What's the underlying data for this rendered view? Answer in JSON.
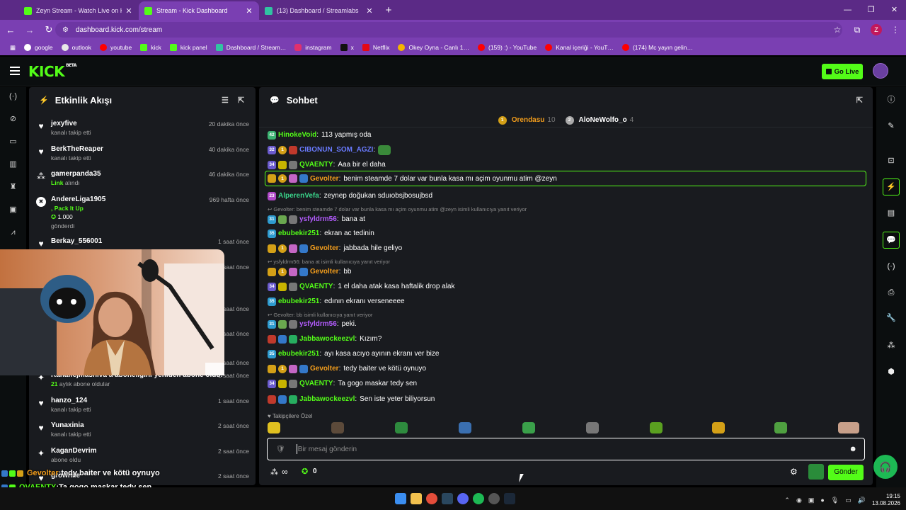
{
  "browser": {
    "tabs": [
      {
        "title": "Zeyn Stream - Watch Live on Ki…",
        "active": false
      },
      {
        "title": "Stream - Kick Dashboard",
        "active": true
      },
      {
        "title": "(13) Dashboard / Streamlabs",
        "active": false
      }
    ],
    "new_tab": "+",
    "url": "dashboard.kick.com/stream",
    "profile_initial": "Z",
    "bookmarks": [
      "google",
      "outlook",
      "youtube",
      "kick",
      "kick panel",
      "Dashboard / Stream…",
      "instagram",
      "x",
      "Netflix",
      "Okey Oyna - Canlı 1…",
      "(159) :) - YouTube",
      "Kanal içeriği - YouT…",
      "(174) Mc yayın gelin…"
    ]
  },
  "header": {
    "logo": "KICK",
    "beta": "BETA",
    "go_live": "Go Live"
  },
  "activity": {
    "title": "Etkinlik Akışı",
    "events": [
      {
        "name": "jexyfive",
        "sub": "kanalı takip etti",
        "time": "20 dakika önce",
        "icon": "heart-icon"
      },
      {
        "name": "BerkTheReaper",
        "sub": "kanalı takip etti",
        "time": "40 dakika önce",
        "icon": "heart-icon"
      },
      {
        "name": "gamerpanda35",
        "sub_highlight": "Link",
        "sub": "alındı",
        "time": "46 dakika önce",
        "icon": "redeem-icon"
      },
      {
        "name": "AndereLiga1905",
        "sub_highlight": ", Pack It Up",
        "amount": "1.000",
        "sub": "gönderdi",
        "time": "969 hafta önce",
        "icon": "kick-icon"
      },
      {
        "name": "Berkay_556001",
        "sub": "",
        "time": "1 saat önce",
        "icon": "heart-icon"
      },
      {
        "name": "",
        "sub": "",
        "time": "1 saat önce",
        "icon": ""
      },
      {
        "name": "",
        "sub": "",
        "time": "1 saat önce",
        "icon": ""
      },
      {
        "name": "",
        "sub": "",
        "time": "1 saat önce",
        "icon": ""
      },
      {
        "name": "",
        "sub": "",
        "time": "1 saat önce",
        "icon": ""
      },
      {
        "name": "Kanalfejmashiva a aboneliğini yeniden abone oldu!",
        "sub_highlight": "21",
        "sub": "aylık abone oldular",
        "time": "1 saat önce",
        "icon": "sparkle-icon"
      },
      {
        "name": "hanzo_124",
        "sub": "kanalı takip etti",
        "time": "1 saat önce",
        "icon": "heart-icon"
      },
      {
        "name": "Yunaxinia",
        "sub": "kanalı takip etti",
        "time": "2 saat önce",
        "icon": "heart-icon"
      },
      {
        "name": "KaganDevrim",
        "sub": "abone oldu",
        "time": "2 saat önce",
        "icon": "sparkle-icon"
      },
      {
        "name": "grownile",
        "sub": "",
        "time": "2 saat önce",
        "icon": "heart-icon"
      }
    ]
  },
  "chat": {
    "title": "Sohbet",
    "pinned": [
      {
        "name": "Orendasu",
        "count": "10"
      },
      {
        "name": "AloNeWolfo_o",
        "count": "4"
      }
    ],
    "messages": [
      {
        "badges": [
          "#3cb371:42"
        ],
        "user": "HinokeVoid",
        "color": "#53fc18",
        "text": "113 yapmış oda"
      },
      {
        "badges": [
          "#6a5acd:32",
          "#d4a017:1",
          "#c0392b:"
        ],
        "user": "CIBONUN_SOM_AGZI",
        "color": "#6a7bff",
        "text": "",
        "emote": true
      },
      {
        "badges": [
          "#6a5acd:34",
          "#c8b400:",
          "#777:"
        ],
        "user": "QVAENTY",
        "color": "#53fc18",
        "text": "Aaa bir el daha"
      },
      {
        "badges": [
          "#d4a017:",
          "#d4a017:1",
          "#c466c4:",
          "#3478c9:"
        ],
        "user": "Gevolter",
        "color": "#f29d1c",
        "text": "benim steamde 7 dolar var bunla kasa mı açim oyunmu atim @zeyn",
        "highlight": true
      },
      {
        "badges": [
          "#b048c8:23"
        ],
        "user": "AlperenVefa",
        "color": "#3ad38a",
        "text": "zeynep doğukan sduıobsjbosujbsd"
      },
      {
        "reply": "Gevolter: benim steamde 7 dolar var bunla kasa mı açim oyunmu atim @zeyn isimli kullanıcıya yanıt veriyor"
      },
      {
        "badges": [
          "#2e9bcf:31",
          "#6aa84f:",
          "#777:"
        ],
        "user": "ysfyldrm56",
        "color": "#b45cff",
        "text": "bana at"
      },
      {
        "badges": [
          "#2e9bcf:35"
        ],
        "user": "ebubekir251",
        "color": "#53fc18",
        "text": "ekran ac tedinin"
      },
      {
        "badges": [
          "#d4a017:",
          "#d4a017:1",
          "#c466c4:",
          "#3478c9:"
        ],
        "user": "Gevolter",
        "color": "#f29d1c",
        "text": "jabbada hile geliyo"
      },
      {
        "reply": "ysfyldrm56: bana at isimli kullanıcıya yanıt veriyor"
      },
      {
        "badges": [
          "#d4a017:",
          "#d4a017:1",
          "#c466c4:",
          "#3478c9:"
        ],
        "user": "Gevolter",
        "color": "#f29d1c",
        "text": "bb"
      },
      {
        "badges": [
          "#6a5acd:34",
          "#c8b400:",
          "#777:"
        ],
        "user": "QVAENTY",
        "color": "#53fc18",
        "text": "1 el daha atak kasa haftalik drop alak"
      },
      {
        "badges": [
          "#2e9bcf:35"
        ],
        "user": "ebubekir251",
        "color": "#53fc18",
        "text": "edının ekranı verseneeee"
      },
      {
        "reply": "Gevolter: bb isimli kullanıcıya yanıt veriyor"
      },
      {
        "badges": [
          "#2e9bcf:31",
          "#6aa84f:",
          "#777:"
        ],
        "user": "ysfyldrm56",
        "color": "#b45cff",
        "text": "peki."
      },
      {
        "badges": [
          "#c0392b:",
          "#3478c9:",
          "#27ae60:"
        ],
        "user": "Jabbawockeezvl",
        "color": "#53fc18",
        "text": "Kızım?"
      },
      {
        "badges": [
          "#2e9bcf:35"
        ],
        "user": "ebubekir251",
        "color": "#53fc18",
        "text": "ayı kasa acıyo ayının ekranı ver bize"
      },
      {
        "badges": [
          "#d4a017:",
          "#d4a017:1",
          "#c466c4:",
          "#3478c9:"
        ],
        "user": "Gevolter",
        "color": "#f29d1c",
        "text": "tedy baiter ve kötü oynuyo"
      },
      {
        "badges": [
          "#6a5acd:34",
          "#c8b400:",
          "#777:"
        ],
        "user": "QVAENTY",
        "color": "#53fc18",
        "text": "Ta gogo maskar tedy sen"
      },
      {
        "badges": [
          "#c0392b:",
          "#3478c9:",
          "#27ae60:"
        ],
        "user": "Jabbawockeezvl",
        "color": "#53fc18",
        "text": "Sen iste yeter biliyorsun"
      }
    ],
    "emote_section": "Takipçilere Özel",
    "input_placeholder": "Bir mesaj gönderin",
    "footer_count_left": "∞",
    "footer_count_right": "0",
    "send": "Gönder"
  },
  "stream_overlay": [
    {
      "user": "Gevolter",
      "color": "#f29d1c",
      "text": "tedy baiter ve kötü oynuyo"
    },
    {
      "user": "QVAENTY",
      "color": "#53fc18",
      "text": "Ta gogo maskar tedy sen"
    },
    {
      "user": "Jabbawockeezvl",
      "color": "#53fc18",
      "text": "Sen iste yeter biliyorsun"
    }
  ],
  "taskbar": {
    "time": "19:15",
    "date": "13.08.2026"
  }
}
